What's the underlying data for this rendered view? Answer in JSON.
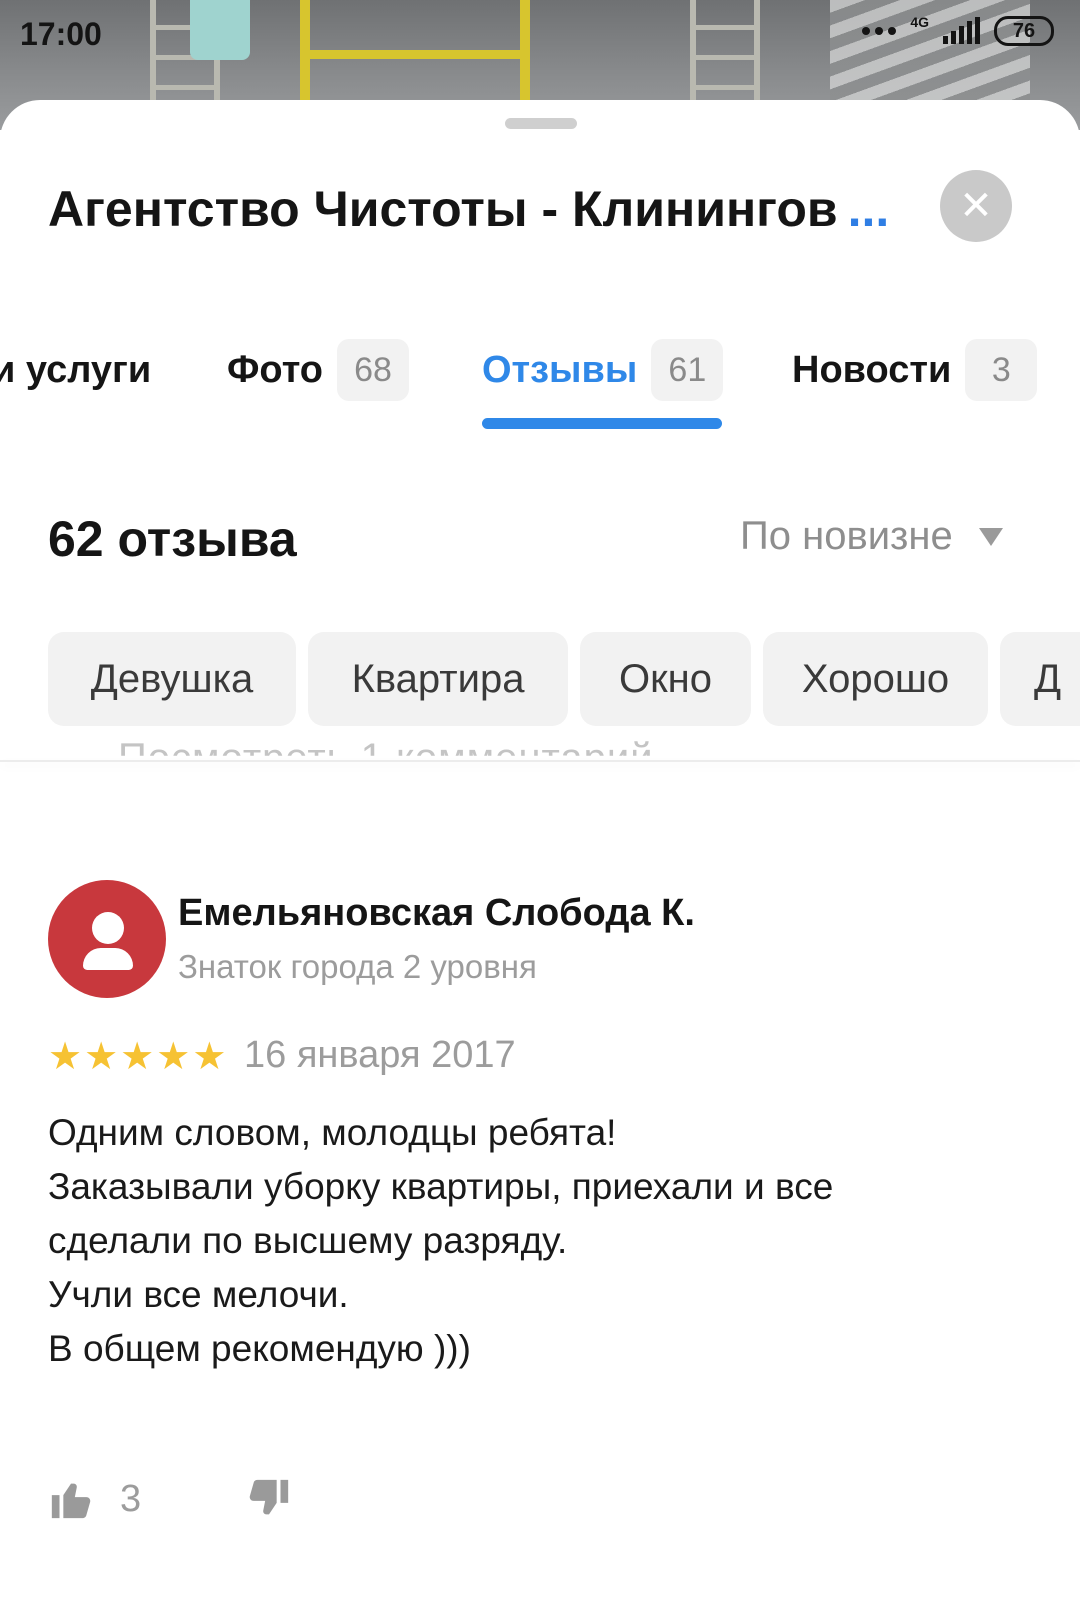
{
  "status_bar": {
    "time": "17:00",
    "network": "4G",
    "battery": "76"
  },
  "header": {
    "title": "Агентство Чистоты - Клинингов",
    "more": "...",
    "close_icon": "close-icon"
  },
  "tabs": [
    {
      "label": "и услуги",
      "count": ""
    },
    {
      "label": "Фото",
      "count": "68"
    },
    {
      "label": "Отзывы",
      "count": "61",
      "active": true
    },
    {
      "label": "Новости",
      "count": "3"
    }
  ],
  "reviews": {
    "count_label": "62 отзыва",
    "sort_label": "По новизне",
    "chips": [
      "Девушка",
      "Квартира",
      "Окно",
      "Хорошо",
      "Д"
    ],
    "peek_text": "Посмотреть 1 комментарий"
  },
  "review": {
    "author": "Емельяновская Слобода К.",
    "level": "Знаток города 2 уровня",
    "rating": 5,
    "date": "16 января 2017",
    "lines": [
      "Одним словом, молодцы ребята!",
      "Заказывали уборку квартиры, приехали и все",
      "сделали по высшему разряду.",
      "Учли все мелочи.",
      "В общем рекомендую )))"
    ],
    "likes": "3"
  },
  "colors": {
    "accent": "#2f88e8",
    "avatar": "#c8383d",
    "star": "#f6c233"
  }
}
